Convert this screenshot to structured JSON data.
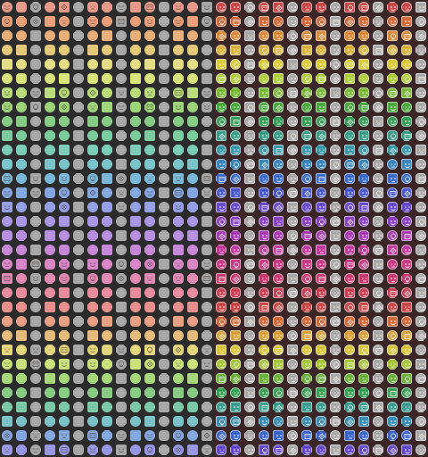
{
  "sprite_sheet": {
    "background": "#2b2b2b",
    "right_panel_background": "#3a2626",
    "columns_per_panel": 15,
    "rows": 32,
    "row_colors": [
      "#e89a8a",
      "#e8a07a",
      "#e8b07a",
      "#e6c87a",
      "#e6de86",
      "#d8e47c",
      "#b8dc7c",
      "#9ed47a",
      "#86cc86",
      "#7ccc9e",
      "#7cccb8",
      "#7cc4cc",
      "#7cb8d8",
      "#86a8e0",
      "#96a0e4",
      "#a898e4",
      "#b890e0",
      "#c888d8",
      "#d888c8",
      "#e08ab4",
      "#e88ca0",
      "#e8908e",
      "#e8a084",
      "#e6bc7c",
      "#e4d67c",
      "#cce07c",
      "#a8d87c",
      "#88cc84",
      "#7cc8a8",
      "#7cc0c8",
      "#86a8e0",
      "#9a98e4"
    ],
    "right_row_colors": [
      "#c84848",
      "#d06a3a",
      "#d88a3a",
      "#d8b03a",
      "#d8cc3a",
      "#b0cc3a",
      "#7ab83a",
      "#4aa83e",
      "#3a9c5a",
      "#3a9c86",
      "#3a98a8",
      "#3a84b8",
      "#3a6cc8",
      "#4a58c8",
      "#6a4ac8",
      "#8a42c0",
      "#a63ab0",
      "#c03a9c",
      "#c83a84",
      "#c83a6c",
      "#c84058",
      "#c84848",
      "#d06a3a",
      "#d8a03a",
      "#d8c43a",
      "#a8c43a",
      "#6ab03a",
      "#3aa056",
      "#3a9c8c",
      "#3a8cb0",
      "#3a64c8",
      "#6048c8"
    ],
    "neutral_color": "#a8a8a8",
    "shape_pattern": [
      "circle",
      "rounded",
      "octa",
      "circle",
      "square"
    ],
    "glyph_pattern": [
      "face",
      "hearts",
      "skull",
      "box",
      "diamond",
      "face",
      "dash"
    ]
  }
}
